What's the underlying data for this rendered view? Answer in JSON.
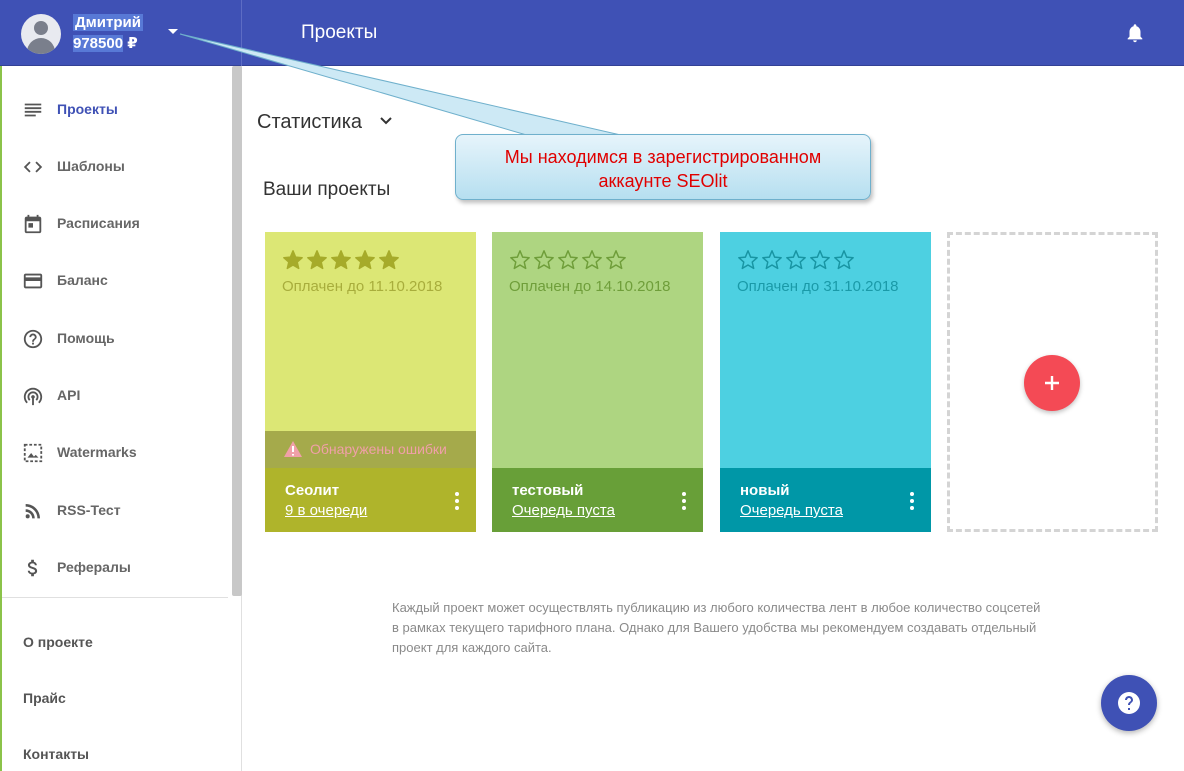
{
  "header": {
    "user_name": "Дмитрий",
    "balance_number": "978500",
    "balance_currency": " ₽",
    "page_title": "Проекты"
  },
  "sidebar": {
    "items": [
      {
        "label": "Проекты",
        "icon": "list-icon",
        "active": true
      },
      {
        "label": "Шаблоны",
        "icon": "code-icon"
      },
      {
        "label": "Расписания",
        "icon": "calendar-icon"
      },
      {
        "label": "Баланс",
        "icon": "credit-card-icon"
      },
      {
        "label": "Помощь",
        "icon": "help-circle-icon"
      },
      {
        "label": "API",
        "icon": "antenna-icon"
      },
      {
        "label": "Watermarks",
        "icon": "watermark-icon"
      },
      {
        "label": "RSS-Тест",
        "icon": "rss-icon"
      },
      {
        "label": "Рефералы",
        "icon": "dollar-icon"
      }
    ],
    "links": [
      "О проекте",
      "Прайс",
      "Контакты"
    ]
  },
  "main": {
    "stats_label": "Статистика",
    "section_title": "Ваши проекты",
    "projects": [
      {
        "name": "Сеолит",
        "paid_until": "Оплачен до 11.10.2018",
        "queue": "9 в очереди",
        "rating": 5,
        "warning": "Обнаружены ошибки",
        "bg": "#dce775",
        "footer_bg": "#afb42b",
        "text_color": "#a8ad3c",
        "star_color": "#a6ab2a"
      },
      {
        "name": "тестовый",
        "paid_until": "Оплачен до 14.10.2018",
        "queue": "Очередь пуста",
        "rating": 0,
        "bg": "#aed581",
        "footer_bg": "#689f38",
        "text_color": "#6f9e3a",
        "star_color": "#6f9e3a"
      },
      {
        "name": "новый",
        "paid_until": "Оплачен до 31.10.2018",
        "queue": "Очередь пуста",
        "rating": 0,
        "bg": "#4dd0e1",
        "footer_bg": "#0097a7",
        "text_color": "#1a9aa8",
        "star_color": "#1895a3"
      }
    ],
    "info_text": "Каждый проект может осуществлять публикацию из любого количества лент в любое количество соцсетей в рамках текущего тарифного плана. Однако для Вашего удобства мы рекомендуем создавать отдельный проект для каждого сайта."
  },
  "callout": {
    "line1": "Мы находимся в зарегистрированном",
    "line2": "аккаунте SEOlit"
  },
  "colors": {
    "primary": "#3f51b5",
    "accent": "#f44a55"
  }
}
